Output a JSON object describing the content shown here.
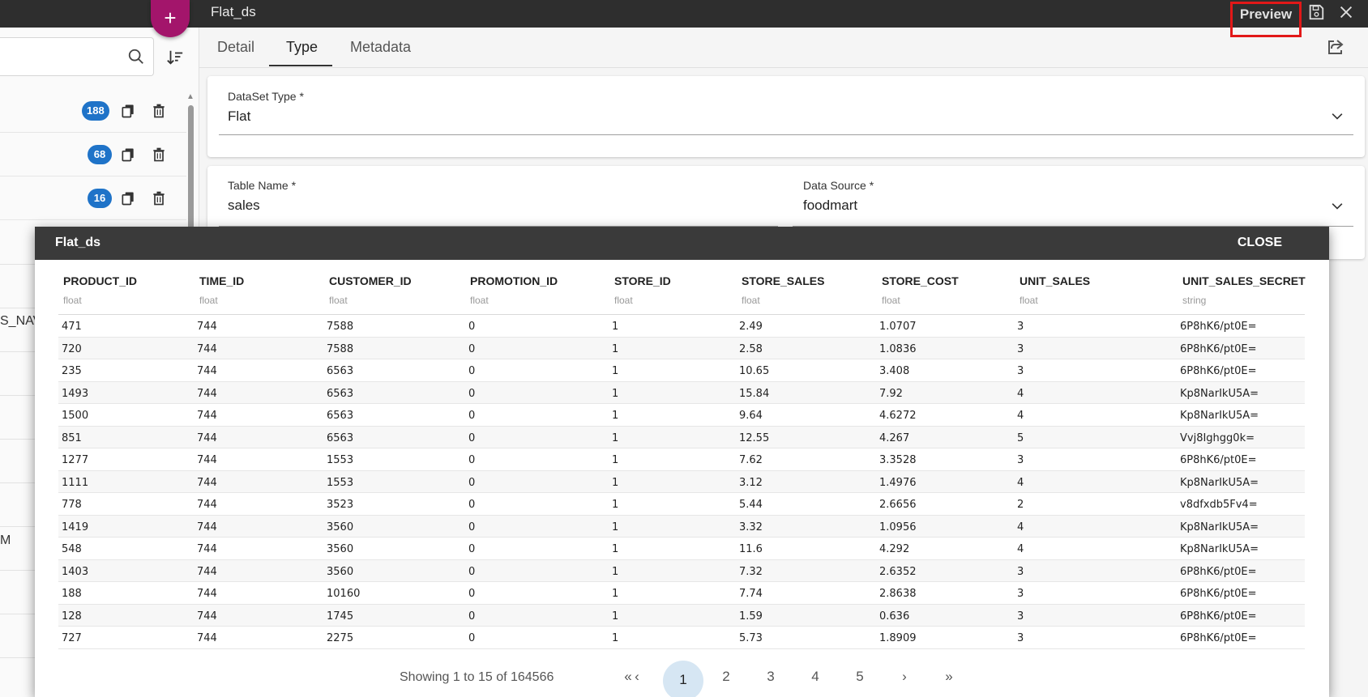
{
  "left_panel": {
    "fab_label": "+",
    "rows": [
      {
        "count": "188"
      },
      {
        "count": "68"
      },
      {
        "count": "16"
      }
    ],
    "partial_texts": [
      "S_NAV",
      "M"
    ]
  },
  "topbar": {
    "title": "Flat_ds",
    "preview_label": "Preview"
  },
  "tabs": [
    "Detail",
    "Type",
    "Metadata"
  ],
  "active_tab": "Type",
  "dataset_type": {
    "label": "DataSet Type *",
    "value": "Flat"
  },
  "table_name": {
    "label": "Table Name *",
    "value": "sales"
  },
  "data_source": {
    "label": "Data Source *",
    "value": "foodmart"
  },
  "dialog": {
    "title": "Flat_ds",
    "close_label": "CLOSE",
    "columns": [
      {
        "name": "PRODUCT_ID",
        "type": "float"
      },
      {
        "name": "TIME_ID",
        "type": "float"
      },
      {
        "name": "CUSTOMER_ID",
        "type": "float"
      },
      {
        "name": "PROMOTION_ID",
        "type": "float"
      },
      {
        "name": "STORE_ID",
        "type": "float"
      },
      {
        "name": "STORE_SALES",
        "type": "float"
      },
      {
        "name": "STORE_COST",
        "type": "float"
      },
      {
        "name": "UNIT_SALES",
        "type": "float"
      },
      {
        "name": "UNIT_SALES_SECRET",
        "type": "string"
      }
    ],
    "rows": [
      [
        "471",
        "744",
        "7588",
        "0",
        "1",
        "2.49",
        "1.0707",
        "3",
        "6P8hK6/pt0E="
      ],
      [
        "720",
        "744",
        "7588",
        "0",
        "1",
        "2.58",
        "1.0836",
        "3",
        "6P8hK6/pt0E="
      ],
      [
        "235",
        "744",
        "6563",
        "0",
        "1",
        "10.65",
        "3.408",
        "3",
        "6P8hK6/pt0E="
      ],
      [
        "1493",
        "744",
        "6563",
        "0",
        "1",
        "15.84",
        "7.92",
        "4",
        "Kp8NarIkU5A="
      ],
      [
        "1500",
        "744",
        "6563",
        "0",
        "1",
        "9.64",
        "4.6272",
        "4",
        "Kp8NarIkU5A="
      ],
      [
        "851",
        "744",
        "6563",
        "0",
        "1",
        "12.55",
        "4.267",
        "5",
        "Vvj8Ighgg0k="
      ],
      [
        "1277",
        "744",
        "1553",
        "0",
        "1",
        "7.62",
        "3.3528",
        "3",
        "6P8hK6/pt0E="
      ],
      [
        "1111",
        "744",
        "1553",
        "0",
        "1",
        "3.12",
        "1.4976",
        "4",
        "Kp8NarIkU5A="
      ],
      [
        "778",
        "744",
        "3523",
        "0",
        "1",
        "5.44",
        "2.6656",
        "2",
        "v8dfxdb5Fv4="
      ],
      [
        "1419",
        "744",
        "3560",
        "0",
        "1",
        "3.32",
        "1.0956",
        "4",
        "Kp8NarIkU5A="
      ],
      [
        "548",
        "744",
        "3560",
        "0",
        "1",
        "11.6",
        "4.292",
        "4",
        "Kp8NarIkU5A="
      ],
      [
        "1403",
        "744",
        "3560",
        "0",
        "1",
        "7.32",
        "2.6352",
        "3",
        "6P8hK6/pt0E="
      ],
      [
        "188",
        "744",
        "10160",
        "0",
        "1",
        "7.74",
        "2.8638",
        "3",
        "6P8hK6/pt0E="
      ],
      [
        "128",
        "744",
        "1745",
        "0",
        "1",
        "1.59",
        "0.636",
        "3",
        "6P8hK6/pt0E="
      ],
      [
        "727",
        "744",
        "2275",
        "0",
        "1",
        "5.73",
        "1.8909",
        "3",
        "6P8hK6/pt0E="
      ]
    ],
    "pagination": {
      "summary": "Showing 1 to 15 of 164566",
      "first": "«",
      "prev": "‹",
      "current": "1",
      "pages": [
        "2",
        "3",
        "4",
        "5"
      ],
      "next": "›",
      "last": "»"
    }
  }
}
